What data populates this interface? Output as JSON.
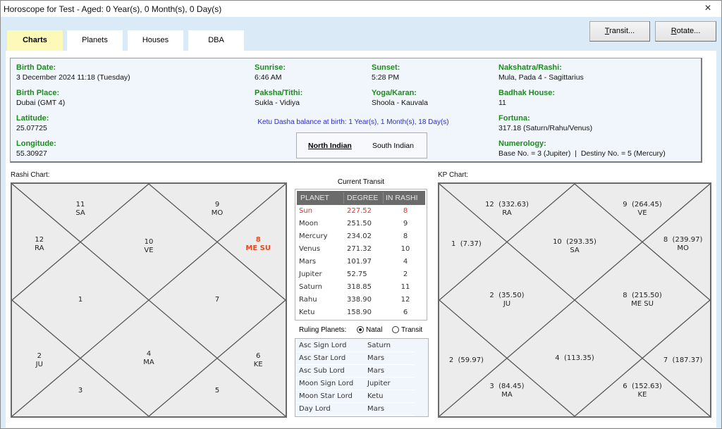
{
  "window": {
    "title": "Horoscope for Test - Aged: 0 Year(s), 0 Month(s), 0 Day(s)",
    "close_icon": "×"
  },
  "tabs": [
    {
      "label": "Charts",
      "active": true
    },
    {
      "label": "Planets",
      "active": false
    },
    {
      "label": "Houses",
      "active": false
    },
    {
      "label": "DBA",
      "active": false
    }
  ],
  "buttons": {
    "transit": {
      "label": "Transit...",
      "accel": "T"
    },
    "rotate": {
      "label": "Rotate...",
      "accel": "R"
    }
  },
  "info": {
    "birth_date": {
      "label": "Birth Date:",
      "value": "3 December 2024 11:18 (Tuesday)"
    },
    "birth_place": {
      "label": "Birth Place:",
      "value": "Dubai (GMT 4)"
    },
    "latitude": {
      "label": "Latitude:",
      "value": "25.07725"
    },
    "longitude": {
      "label": "Longitude:",
      "value": "55.30927"
    },
    "sunrise": {
      "label": "Sunrise:",
      "value": "6:46 AM"
    },
    "paksha_tithi": {
      "label": "Paksha/Tithi:",
      "value": "Sukla - Vidiya"
    },
    "sunset": {
      "label": "Sunset:",
      "value": "5:28 PM"
    },
    "yoga_karan": {
      "label": "Yoga/Karan:",
      "value": "Shoola - Kauvala"
    },
    "nakshatra_rashi": {
      "label": "Nakshatra/Rashi:",
      "value": "Mula, Pada 4 - Sagittarius"
    },
    "badhak_house": {
      "label": "Badhak House:",
      "value": "11"
    },
    "fortuna": {
      "label": "Fortuna:",
      "value": "317.18 (Saturn/Rahu/Venus)"
    },
    "numerology": {
      "label": "Numerology:",
      "value": "Base No. = 3 (Jupiter)  |  Destiny No. = 5 (Mercury)"
    },
    "dasha_balance": "Ketu Dasha balance at birth: 1 Year(s), 1 Month(s), 18 Day(s)",
    "chart_styles": {
      "north": "North Indian",
      "south": "South Indian",
      "selected": "North Indian"
    }
  },
  "rashi_chart": {
    "label": "Rashi Chart:",
    "houses": {
      "top": {
        "line1": "10",
        "line2": "VE"
      },
      "top_left": {
        "line1": "11",
        "line2": "SA"
      },
      "left_top": {
        "line1": "12",
        "line2": "RA"
      },
      "left_center": {
        "line1": "1",
        "line2": ""
      },
      "left_bottom": {
        "line1": "2",
        "line2": "JU"
      },
      "bottom_left": {
        "line1": "3",
        "line2": ""
      },
      "bottom": {
        "line1": "4",
        "line2": "MA"
      },
      "bottom_right": {
        "line1": "5",
        "line2": ""
      },
      "right_bottom": {
        "line1": "6",
        "line2": "KE"
      },
      "right_center": {
        "line1": "7",
        "line2": ""
      },
      "right_top": {
        "line1": "8",
        "line2": "ME SU",
        "highlight": true
      },
      "top_right": {
        "line1": "9",
        "line2": "MO"
      }
    },
    "highlight_color": "#e8491d"
  },
  "kp_chart": {
    "label": "KP Chart:",
    "houses": {
      "top": {
        "line1": "10  (293.35)",
        "line2": "SA"
      },
      "top_left": {
        "line1": "12  (332.63)",
        "line2": "RA"
      },
      "left_top": {
        "line1": "1  (7.37)",
        "line2": ""
      },
      "left_center": {
        "line1": "2  (35.50)",
        "line2": "JU"
      },
      "left_bottom": {
        "line1": "2  (59.97)",
        "line2": ""
      },
      "bottom_left": {
        "line1": "3  (84.45)",
        "line2": "MA"
      },
      "bottom": {
        "line1": "4  (113.35)",
        "line2": ""
      },
      "bottom_right": {
        "line1": "6  (152.63)",
        "line2": "KE"
      },
      "right_bottom": {
        "line1": "7  (187.37)",
        "line2": ""
      },
      "right_center": {
        "line1": "8  (215.50)",
        "line2": "ME SU"
      },
      "right_top": {
        "line1": "8  (239.97)",
        "line2": "MO"
      },
      "top_right": {
        "line1": "9  (264.45)",
        "line2": "VE"
      }
    }
  },
  "transit": {
    "title": "Current Transit",
    "columns": [
      "PLANET",
      "DEGREE",
      "IN RASHI"
    ],
    "rows": [
      {
        "planet": "Sun",
        "degree": "227.52",
        "rashi": "8",
        "highlight": true
      },
      {
        "planet": "Moon",
        "degree": "251.50",
        "rashi": "9"
      },
      {
        "planet": "Mercury",
        "degree": "234.02",
        "rashi": "8"
      },
      {
        "planet": "Venus",
        "degree": "271.32",
        "rashi": "10"
      },
      {
        "planet": "Mars",
        "degree": "101.97",
        "rashi": "4"
      },
      {
        "planet": "Jupiter",
        "degree": "52.75",
        "rashi": "2"
      },
      {
        "planet": "Saturn",
        "degree": "318.85",
        "rashi": "11"
      },
      {
        "planet": "Rahu",
        "degree": "338.90",
        "rashi": "12"
      },
      {
        "planet": "Ketu",
        "degree": "158.90",
        "rashi": "6"
      }
    ],
    "highlight_color": "#ee2b2b"
  },
  "ruling_planets": {
    "label": "Ruling Planets:",
    "options": [
      {
        "label": "Natal",
        "selected": true
      },
      {
        "label": "Transit",
        "selected": false
      }
    ],
    "rows": [
      {
        "name": "Asc Sign Lord",
        "value": "Saturn"
      },
      {
        "name": "Asc Star Lord",
        "value": "Mars"
      },
      {
        "name": "Asc Sub Lord",
        "value": "Mars"
      },
      {
        "name": "Moon Sign Lord",
        "value": "Jupiter"
      },
      {
        "name": "Moon Star Lord",
        "value": "Ketu"
      },
      {
        "name": "Day Lord",
        "value": "Mars"
      }
    ]
  }
}
